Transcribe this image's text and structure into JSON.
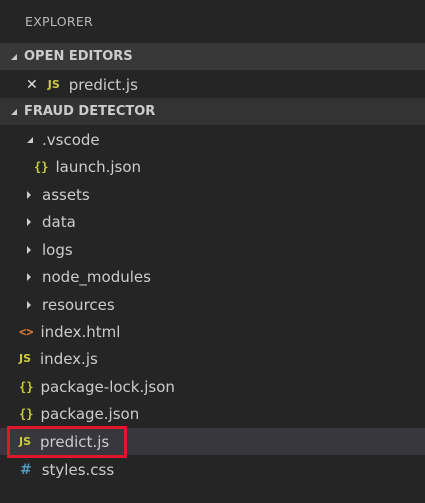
{
  "explorer": {
    "title": "EXPLORER"
  },
  "open_editors": {
    "header": "OPEN EDITORS",
    "items": [
      {
        "icon": "js-file-icon",
        "icon_text": "JS",
        "label": "predict.js"
      }
    ]
  },
  "project": {
    "header": "FRAUD DETECTOR",
    "items": [
      {
        "label": ".vscode",
        "type": "folder",
        "expanded": true
      },
      {
        "label": "launch.json",
        "type": "json",
        "icon_text": "{}"
      },
      {
        "label": "assets",
        "type": "folder",
        "expanded": false
      },
      {
        "label": "data",
        "type": "folder",
        "expanded": false
      },
      {
        "label": "logs",
        "type": "folder",
        "expanded": false
      },
      {
        "label": "node_modules",
        "type": "folder",
        "expanded": false
      },
      {
        "label": "resources",
        "type": "folder",
        "expanded": false
      },
      {
        "label": "index.html",
        "type": "html",
        "icon_text": "<>"
      },
      {
        "label": "index.js",
        "type": "js",
        "icon_text": "JS"
      },
      {
        "label": "package-lock.json",
        "type": "json",
        "icon_text": "{}"
      },
      {
        "label": "package.json",
        "type": "json",
        "icon_text": "{}"
      },
      {
        "label": "predict.js",
        "type": "js",
        "icon_text": "JS",
        "selected": true
      },
      {
        "label": "styles.css",
        "type": "css",
        "icon_text": "#"
      }
    ]
  },
  "colors": {
    "background": "#252526",
    "open_editors_header_bg": "#383838",
    "project_header_bg": "#333333",
    "selected_row_bg": "#37373d",
    "js_icon": "#cbcb41",
    "json_icon": "#cbcb41",
    "html_icon": "#e37933",
    "css_icon": "#519aba",
    "highlight_border": "#e0162b"
  }
}
